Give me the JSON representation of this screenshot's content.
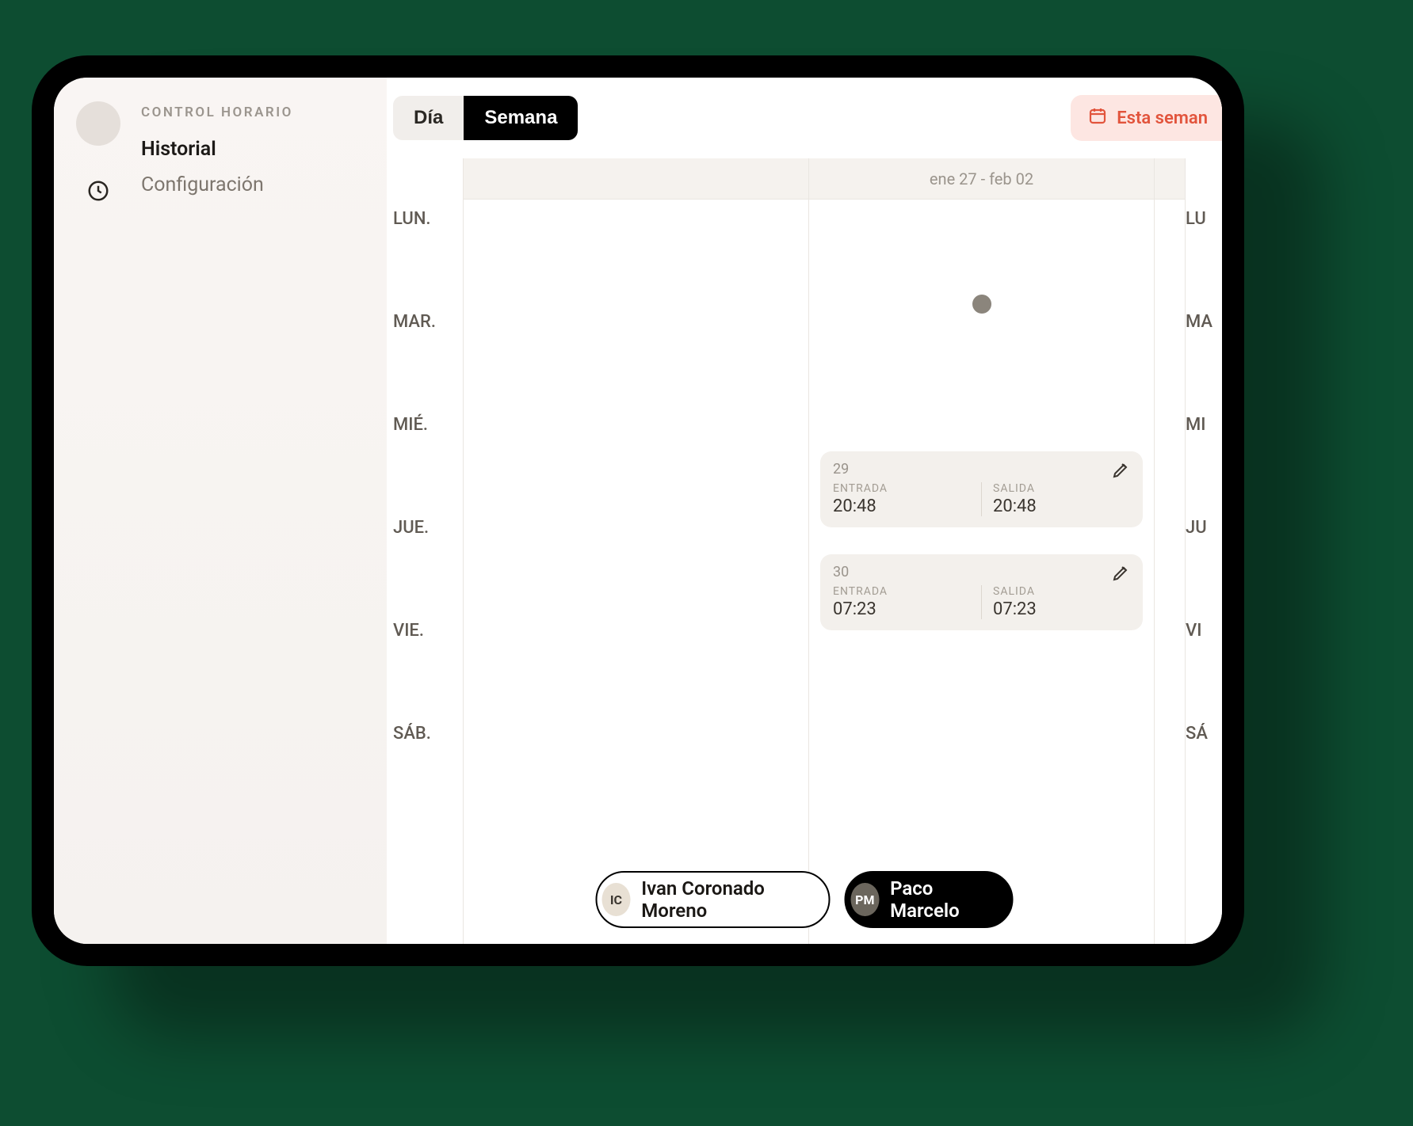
{
  "sidebar": {
    "heading": "CONTROL HORARIO",
    "items": [
      {
        "label": "Historial",
        "active": true
      },
      {
        "label": "Configuración",
        "active": false
      }
    ]
  },
  "topbar": {
    "tabs": {
      "day": "Día",
      "week": "Semana",
      "active": "week"
    },
    "this_week_label": "Esta seman"
  },
  "calendar": {
    "days_left": [
      "LUN.",
      "MAR.",
      "MIÉ.",
      "JUE.",
      "VIE.",
      "SÁB."
    ],
    "days_right": [
      "LU",
      "MA",
      "MI",
      "JU",
      "VI",
      "SÁ"
    ],
    "weeks": [
      {
        "label": ""
      },
      {
        "label": "ene 27 - feb 02"
      },
      {
        "label": ""
      }
    ],
    "entries": [
      {
        "daynum": "29",
        "entrada_label": "ENTRADA",
        "entrada_time": "20:48",
        "salida_label": "SALIDA",
        "salida_time": "20:48"
      },
      {
        "daynum": "30",
        "entrada_label": "ENTRADA",
        "entrada_time": "07:23",
        "salida_label": "SALIDA",
        "salida_time": "07:23"
      }
    ]
  },
  "users": [
    {
      "initials": "IC",
      "name": "Ivan Coronado Moreno",
      "selected": false
    },
    {
      "initials": "PM",
      "name": "Paco Marcelo",
      "selected": true
    }
  ]
}
